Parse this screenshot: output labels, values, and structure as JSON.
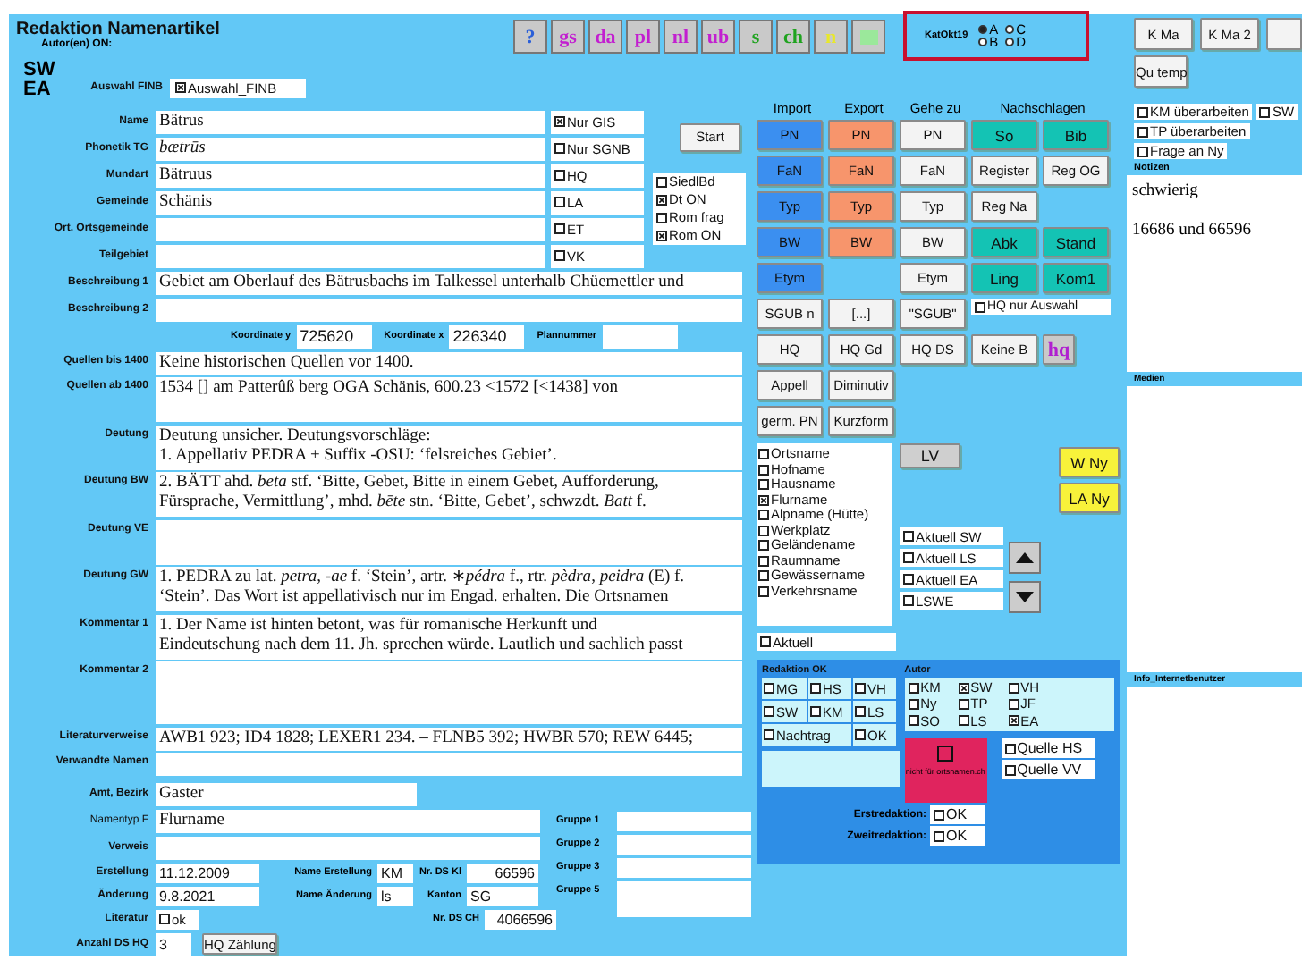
{
  "header": {
    "title": "Redaktion Namenartikel",
    "authors_label": "Autor(en) ON:",
    "authors": [
      "SW",
      "EA"
    ]
  },
  "toolbar": [
    {
      "label": "?",
      "color": "#2a5fd8"
    },
    {
      "label": "gs",
      "color": "#c21fd0"
    },
    {
      "label": "da",
      "color": "#c21fd0"
    },
    {
      "label": "pl",
      "color": "#c21fd0"
    },
    {
      "label": "nl",
      "color": "#c21fd0"
    },
    {
      "label": "ub",
      "color": "#c21fd0"
    },
    {
      "label": "s",
      "color": "#1fa31f"
    },
    {
      "label": "ch",
      "color": "#1fa31f"
    },
    {
      "label": "n",
      "color": "#e8e82a"
    },
    {
      "color": "#9be89b"
    }
  ],
  "catalog": {
    "label": "KatOkt19",
    "options": [
      {
        "label": "A",
        "selected": true
      },
      {
        "label": "C",
        "selected": false
      },
      {
        "label": "B",
        "selected": false
      },
      {
        "label": "D",
        "selected": false
      }
    ]
  },
  "selection": {
    "label": "Auswahl FINB",
    "value": "Auswahl_FINB",
    "checked": true
  },
  "fields_top": [
    {
      "label": "Name",
      "value": "Bätrus",
      "kind": "plain"
    },
    {
      "label": "Phonetik TG",
      "value": "bætrūs",
      "kind": "phonetic"
    },
    {
      "label": "Mundart",
      "value": "Bätruus",
      "kind": "plain"
    },
    {
      "label": "Gemeinde",
      "value": "Schänis",
      "kind": "plain"
    },
    {
      "label": "Ort. Ortsgemeinde",
      "kind": "plain"
    },
    {
      "label": "Teilgebiet",
      "kind": "plain"
    }
  ],
  "filters": [
    {
      "label": "Nur GIS",
      "checked": true
    },
    {
      "label": "Nur SGNB",
      "checked": false
    },
    {
      "label": "HQ",
      "checked": false
    },
    {
      "label": "LA",
      "checked": false
    },
    {
      "label": "ET",
      "checked": false
    },
    {
      "label": "VK",
      "checked": false
    }
  ],
  "start_button": "Start",
  "language_flags": [
    {
      "label": "SiedlBd",
      "checked": false
    },
    {
      "label": "Dt ON",
      "checked": true
    },
    {
      "label": "Rom frag",
      "checked": false
    },
    {
      "label": "Rom ON",
      "checked": true
    }
  ],
  "descriptions": [
    {
      "label": "Beschreibung 1",
      "value": "Gebiet am Oberlauf des Bätrusbachs im Talkessel unterhalb Chüemettler und"
    },
    {
      "label": "Beschreibung 2"
    }
  ],
  "coordinates": [
    {
      "label": "Koordinate y",
      "value": "725620"
    },
    {
      "label": "Koordinate x",
      "value": "226340"
    },
    {
      "label": "Plannummer"
    }
  ],
  "texts": [
    {
      "label": "Quellen bis 1400",
      "kind": "line",
      "lines": [
        "Keine historischen Quellen vor 1400."
      ]
    },
    {
      "label": "Quellen ab 1400",
      "kind": "box",
      "lines": [
        "1534 [] am Patterûß berg OGA Schänis, 600.23 <1572 [<1438] von"
      ]
    },
    {
      "label": "Deutung",
      "kind": "box",
      "lines": [
        "Deutung unsicher. Deutungsvorschläge:",
        "1. Appellativ PEDRA + Suffix -OSU: ‘felsreiches Gebiet’."
      ]
    },
    {
      "label": "Deutung BW",
      "kind": "box",
      "lines": [
        "2. BÄTT ahd. *beta* stf. ‘Bitte, Gebet, Bitte in einem Gebet, Aufforderung,",
        "Fürsprache, Vermittlung’, mhd. *bēte* stn. ‘Bitte, Gebet’, schwzdt. *Batt* f."
      ]
    },
    {
      "label": "Deutung VE",
      "kind": "box"
    },
    {
      "label": "Deutung GW",
      "kind": "box",
      "lines": [
        "1. PEDRA zu lat. *petra*, *-ae* f. ‘Stein’, artr. ∗*pédra* f., rtr. *pèdra*, *peidra* (E) f.",
        "‘Stein’. Das Wort ist appellativisch nur im Engad. erhalten. Die Ortsnamen"
      ]
    },
    {
      "label": "Kommentar 1",
      "kind": "box",
      "lines": [
        "1. Der Name ist hinten betont, was für romanische Herkunft und",
        "Eindeutschung nach dem 11. Jh. sprechen würde. Lautlich und sachlich passt"
      ]
    },
    {
      "label": "Kommentar 2",
      "kind": "tall"
    },
    {
      "label": "Literaturverweise",
      "kind": "line",
      "lines": [
        "AWB1 923; ID4 1828; LEXER1 234. – FLNB5 392; HWBR 570; REW 6445;"
      ]
    },
    {
      "label": "Verwandte Namen",
      "kind": "line"
    }
  ],
  "area": {
    "label": "Amt, Bezirk",
    "value": "Gaster"
  },
  "name_type": {
    "label": "Namentyp F",
    "value": "Flurname"
  },
  "reference": {
    "label": "Verweis"
  },
  "groups": [
    {
      "label": "Gruppe 1",
      "kind": "line"
    },
    {
      "label": "Gruppe 2",
      "kind": "line"
    },
    {
      "label": "Gruppe 3",
      "kind": "line"
    },
    {
      "label": "Gruppe 5",
      "kind": "box"
    }
  ],
  "meta": {
    "created": {
      "label": "Erstellung",
      "value": "11.12.2009"
    },
    "creator": {
      "label": "Name Erstellung",
      "value": "KM"
    },
    "ds_kl": {
      "label": "Nr. DS Kl",
      "value": "66596"
    },
    "changed": {
      "label": "Änderung",
      "value": "9.8.2021"
    },
    "changer": {
      "label": "Name Änderung",
      "value": "ls"
    },
    "canton": {
      "label": "Kanton",
      "value": "SG"
    },
    "literature": {
      "label": "Literatur",
      "option": "ok",
      "checked": false
    },
    "ds_ch": {
      "label": "Nr. DS CH",
      "value": "4066596"
    },
    "count": {
      "label": "Anzahl DS HQ",
      "value": "3",
      "button": "HQ Zählung"
    }
  },
  "column_headers": [
    "Import",
    "Export",
    "Gehe zu",
    "Nachschlagen"
  ],
  "import": [
    "PN",
    "FaN",
    "Typ",
    "BW",
    "Etym"
  ],
  "export": [
    "PN",
    "FaN",
    "Typ",
    "BW"
  ],
  "goto": [
    "PN",
    "FaN",
    "Typ",
    "BW",
    "Etym"
  ],
  "lookup": [
    [
      {
        "label": "So",
        "kind": "primary"
      },
      {
        "label": "Bib",
        "kind": "primary"
      }
    ],
    [
      {
        "label": "Register",
        "kind": "secondary"
      },
      {
        "label": "Reg OG",
        "kind": "secondary"
      }
    ],
    [
      {
        "label": "Reg Na",
        "kind": "secondary"
      }
    ],
    [
      {
        "label": "Abk",
        "kind": "primary"
      },
      {
        "label": "Stand",
        "kind": "primary"
      }
    ],
    [
      {
        "label": "Ling",
        "kind": "primary"
      },
      {
        "label": "Kom1",
        "kind": "primary"
      }
    ]
  ],
  "tool_rows": [
    [
      {
        "label": "SGUB n",
        "kind": "plain"
      },
      {
        "label": "[...]",
        "kind": "plain"
      },
      {
        "label": "\"SGUB\"",
        "kind": "plain"
      }
    ],
    [
      {
        "label": "HQ",
        "kind": "plain"
      },
      {
        "label": "HQ Gd",
        "kind": "plain"
      },
      {
        "label": "HQ DS",
        "kind": "plain"
      },
      {
        "label": "Keine B",
        "kind": "plain"
      },
      {
        "label": "hq",
        "kind": "special"
      }
    ],
    [
      {
        "label": "Appell",
        "kind": "plain"
      },
      {
        "label": "Diminutiv",
        "kind": "plain"
      }
    ],
    [
      {
        "label": "germ. PN",
        "kind": "plain"
      },
      {
        "label": "Kurzform",
        "kind": "plain"
      }
    ]
  ],
  "hq_only": {
    "label": "HQ nur Auswahl",
    "checked": false
  },
  "name_types": [
    {
      "label": "Ortsname",
      "checked": false
    },
    {
      "label": "Hofname",
      "checked": false
    },
    {
      "label": "Hausname",
      "checked": false
    },
    {
      "label": "Flurname",
      "checked": true
    },
    {
      "label": "Alpname (Hütte)",
      "checked": false
    },
    {
      "label": "Werkplatz",
      "checked": false
    },
    {
      "label": "Geländename",
      "checked": false
    },
    {
      "label": "Raumname",
      "checked": false
    },
    {
      "label": "Gewässername",
      "checked": false
    },
    {
      "label": "Verkehrsname",
      "checked": false
    }
  ],
  "lv_button": "LV",
  "ny_buttons": [
    "W Ny",
    "LA Ny"
  ],
  "current": [
    {
      "label": "Aktuell SW",
      "checked": false
    },
    {
      "label": "Aktuell LS",
      "checked": false
    },
    {
      "label": "Aktuell EA",
      "checked": false
    },
    {
      "label": "LSWE",
      "checked": false
    }
  ],
  "current_all": {
    "label": "Aktuell",
    "checked": false
  },
  "editorial": {
    "title": "Redaktion OK",
    "checks": [
      {
        "label": "MG",
        "checked": false
      },
      {
        "label": "HS",
        "checked": false
      },
      {
        "label": "VH",
        "checked": false
      },
      {
        "label": "SW",
        "checked": false
      },
      {
        "label": "KM",
        "checked": false
      },
      {
        "label": "LS",
        "checked": false
      },
      {
        "label": "Nachtrag",
        "checked": false
      },
      {
        "label": "OK",
        "checked": false
      }
    ]
  },
  "author": {
    "title": "Autor",
    "checks": [
      {
        "label": "KM",
        "checked": false
      },
      {
        "label": "SW",
        "checked": true
      },
      {
        "label": "VH",
        "checked": false
      },
      {
        "label": "Ny",
        "checked": false
      },
      {
        "label": "TP",
        "checked": false
      },
      {
        "label": "JF",
        "checked": false
      },
      {
        "label": "SO",
        "checked": false
      },
      {
        "label": "LS",
        "checked": false
      },
      {
        "label": "EA",
        "checked": true
      }
    ]
  },
  "exclude": {
    "label": "nicht für ortsnamen.ch",
    "checked": false
  },
  "sources": [
    {
      "label": "Quelle HS",
      "checked": false
    },
    {
      "label": "Quelle VV",
      "checked": false
    }
  ],
  "reviews": [
    {
      "label": "Erstredaktion:",
      "option": "OK",
      "checked": false
    },
    {
      "label": "Zweitredaktion:",
      "option": "OK",
      "checked": false
    }
  ],
  "right_buttons": [
    "K Ma",
    "K Ma 2"
  ],
  "temp_button": "Qu temp",
  "flags": [
    {
      "label": "KM überarbeiten",
      "checked": false
    },
    {
      "label": "SW",
      "checked": false
    },
    {
      "label": "TP überarbeiten",
      "checked": false
    },
    {
      "label": "Frage an Ny",
      "checked": false
    }
  ],
  "notes": {
    "label": "Notizen",
    "lines": [
      "schwierig",
      "16686 und 66596"
    ]
  },
  "media": {
    "label": "Medien"
  },
  "info": {
    "label": "Info_Internetbenutzer"
  }
}
